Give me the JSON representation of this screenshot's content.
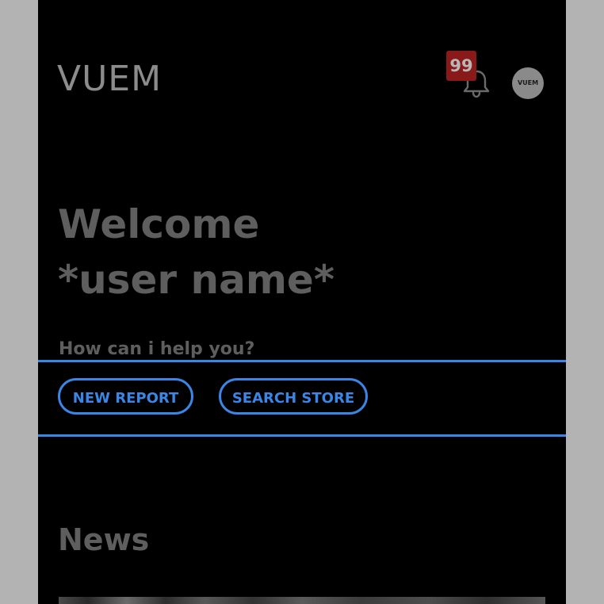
{
  "header": {
    "logo_text": "VUEM",
    "notification_count": "99",
    "avatar_text": "VUEM"
  },
  "welcome": {
    "line1": "Welcome",
    "line2": "*user name*"
  },
  "help": {
    "prompt": "How can i help you?"
  },
  "actions": {
    "new_report_label": "NEW REPORT",
    "search_store_label": "SEARCH STORE"
  },
  "news": {
    "title": "News"
  },
  "colors": {
    "background_outer": "#b3b3b3",
    "screen": "#000000",
    "accent": "#3a86e6",
    "badge": "#8a1a1a",
    "text_dim": "#5e5e5e"
  },
  "icons": {
    "notifications": "bell-icon"
  }
}
